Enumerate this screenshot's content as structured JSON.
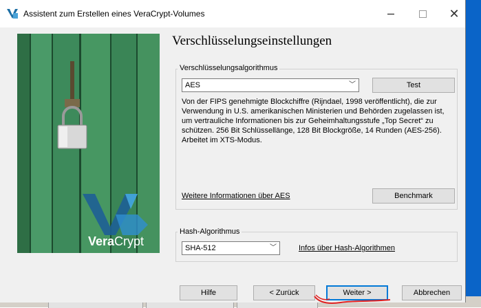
{
  "window": {
    "title": "Assistent zum Erstellen eines VeraCrypt-Volumes"
  },
  "page_title": "Verschlüsselungseinstellungen",
  "encryption": {
    "group_label": "Verschlüsselungsalgorithmus",
    "selected": "AES",
    "test_label": "Test",
    "description": "Von der FIPS genehmigte Blockchiffre (Rijndael, 1998 veröffentlicht), die zur Verwendung in U.S. amerikanischen Ministerien und Behörden zugelassen ist, um vertrauliche Informationen bis zur Geheimhaltungsstufe „Top Secret“ zu schützen. 256 Bit Schlüssellänge, 128 Bit Blockgröße, 14 Runden (AES-256). Arbeitet im XTS-Modus.",
    "more_info_link": "Weitere Informationen über AES",
    "benchmark_label": "Benchmark"
  },
  "hash": {
    "group_label": "Hash-Algorithmus",
    "selected": "SHA-512",
    "info_link": "Infos über Hash-Algorithmen"
  },
  "footer": {
    "help": "Hilfe",
    "back": "< Zurück",
    "next": "Weiter >",
    "cancel": "Abbrechen"
  },
  "banner": {
    "logo_text_bold": "Vera",
    "logo_text_regular": "Crypt"
  },
  "colors": {
    "accent": "#0078d7",
    "desktop": "#0a64c8",
    "banner_green": "#3f8c5e",
    "annotation_red": "#e02020"
  }
}
